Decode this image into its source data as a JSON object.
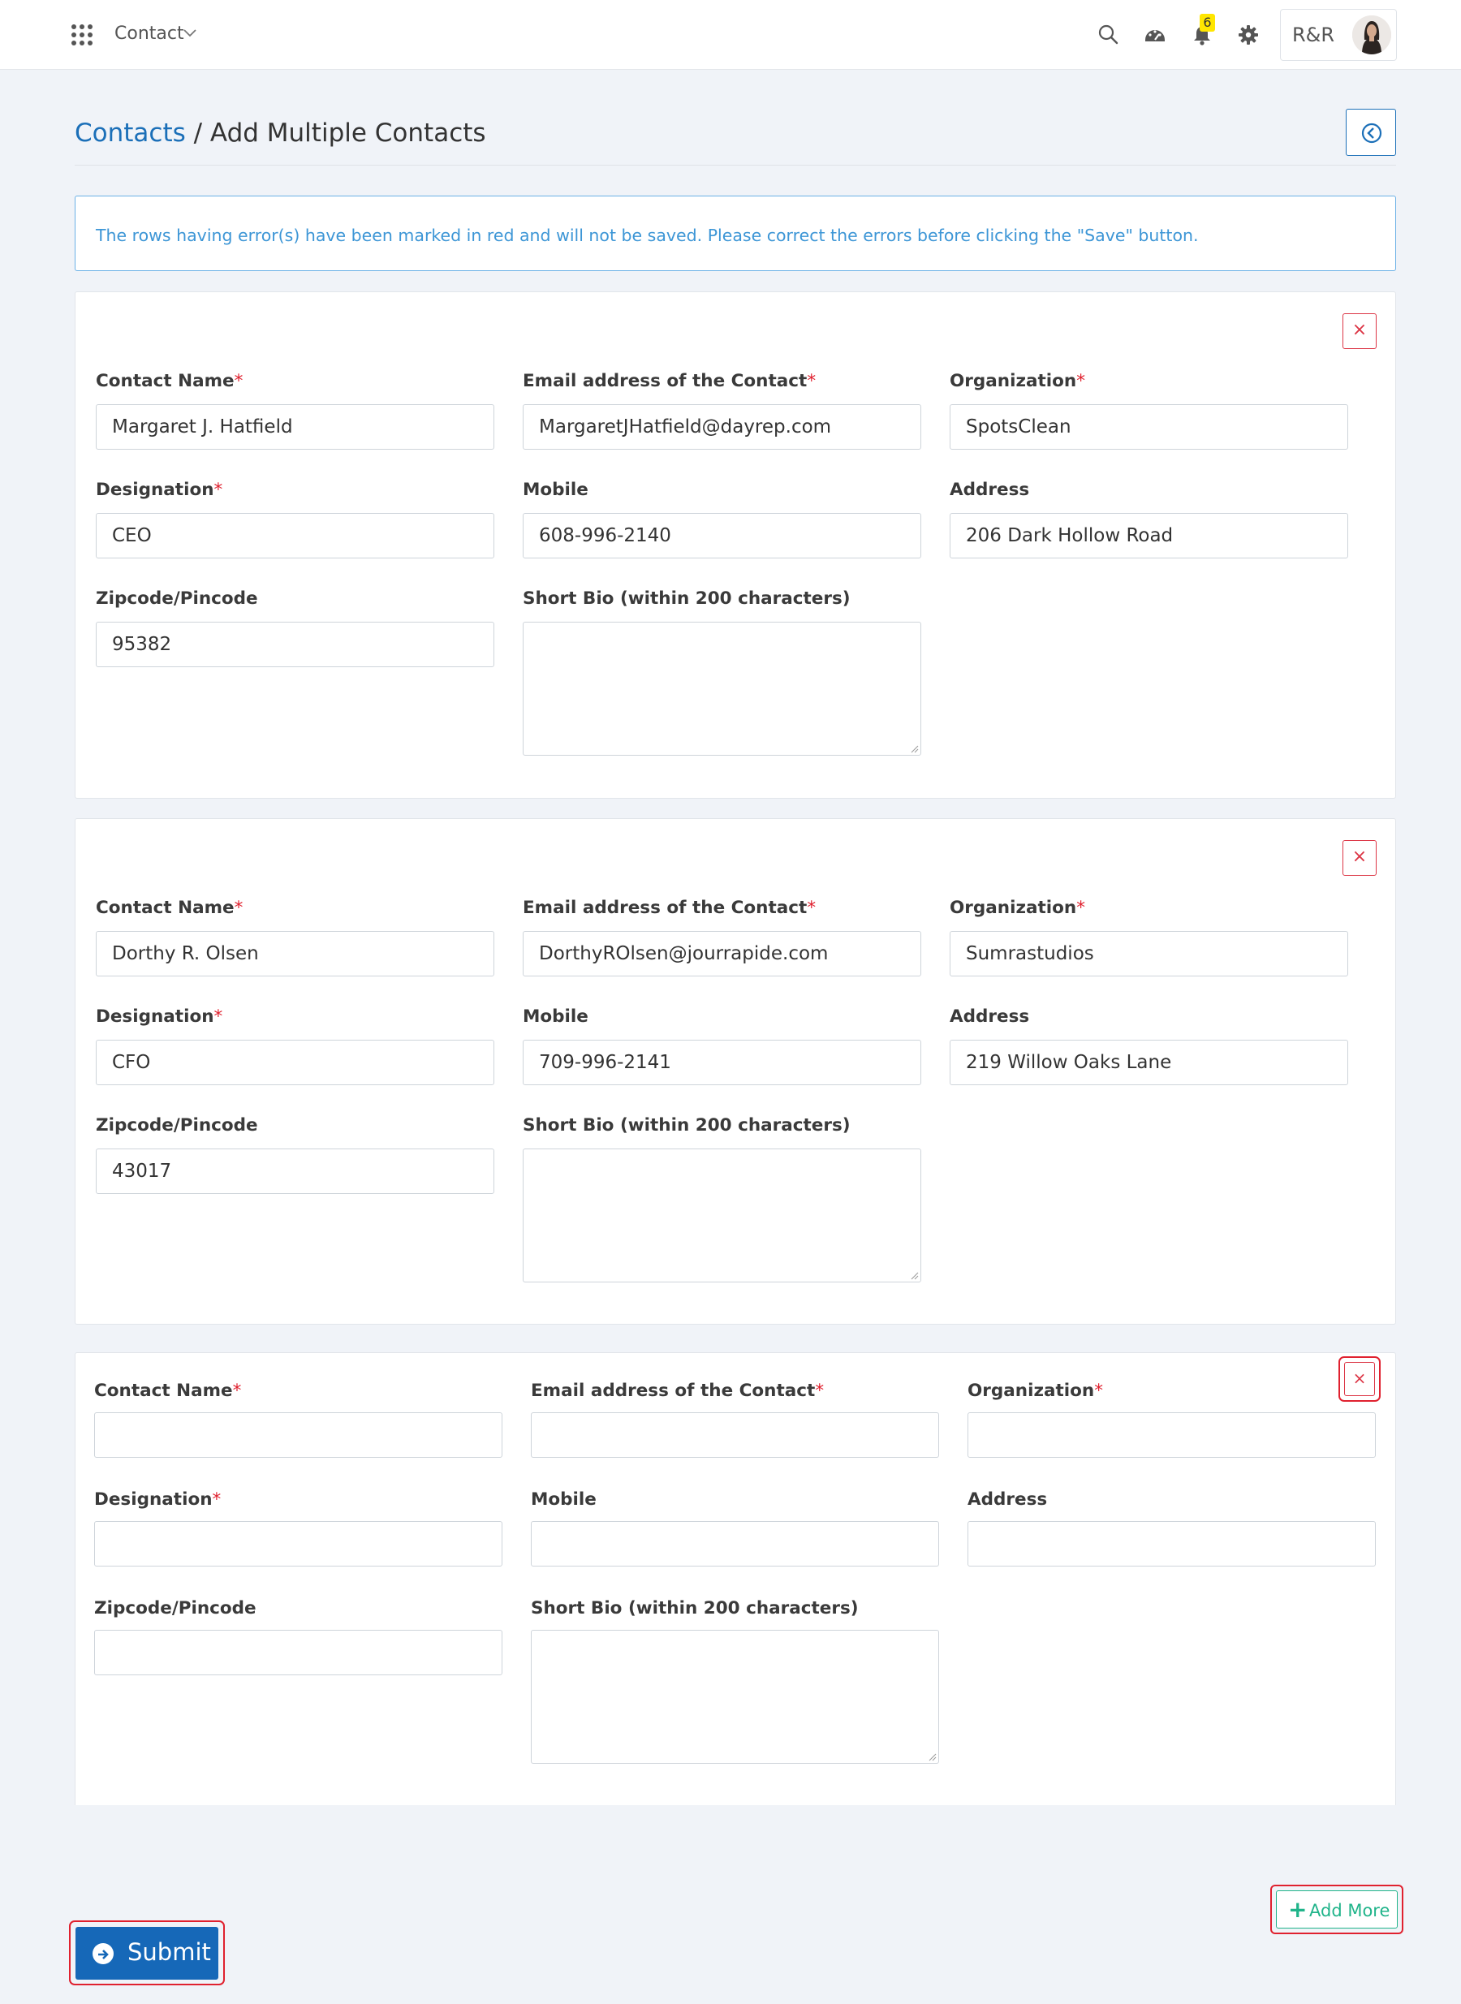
{
  "topbar": {
    "module_name": "Contact",
    "notification_count": "6",
    "user_initials": "R&R",
    "icons": [
      "apps-grid-icon",
      "chevron-down-icon",
      "search-icon",
      "dashboard-gauge-icon",
      "bell-icon",
      "gear-icon"
    ]
  },
  "header": {
    "breadcrumb_link": "Contacts",
    "separator": " / ",
    "title": "Add Multiple Contacts",
    "back_icon": "circle-arrow-left-icon"
  },
  "alert": {
    "message": "The rows having error(s) have been marked in red and will not be saved. Please correct the errors before clicking the \"Save\" button."
  },
  "labels": {
    "contact_name": "Contact Name",
    "email": "Email address of the Contact",
    "organization": "Organization",
    "designation": "Designation",
    "mobile": "Mobile",
    "address": "Address",
    "zipcode": "Zipcode/Pincode",
    "short_bio": "Short Bio (within 200 characters)",
    "required_mark": "*"
  },
  "contacts": [
    {
      "contact_name": "Margaret J. Hatfield",
      "email": "MargaretJHatfield@dayrep.com",
      "organization": "SpotsClean",
      "designation": "CEO",
      "mobile": "608-996-2140",
      "address": "206 Dark Hollow Road",
      "zipcode": "95382",
      "short_bio": ""
    },
    {
      "contact_name": "Dorthy R. Olsen",
      "email": "DorthyROlsen@jourrapide.com",
      "organization": "Sumrastudios",
      "designation": "CFO",
      "mobile": "709-996-2141",
      "address": "219 Willow Oaks Lane",
      "zipcode": "43017",
      "short_bio": ""
    },
    {
      "contact_name": "",
      "email": "",
      "organization": "",
      "designation": "",
      "mobile": "",
      "address": "",
      "zipcode": "",
      "short_bio": ""
    }
  ],
  "remove_label": "×",
  "buttons": {
    "add_more_icon": "+",
    "add_more": "Add More",
    "submit": "Submit",
    "submit_icon": "circle-arrow-right-icon"
  },
  "colors": {
    "primary": "#1668b8",
    "link": "#1b6fb8",
    "danger": "#dc3545",
    "success": "#20b48a",
    "info_text": "#3d96d6",
    "badge": "#ffe600",
    "page_bg": "#f0f3f8"
  }
}
